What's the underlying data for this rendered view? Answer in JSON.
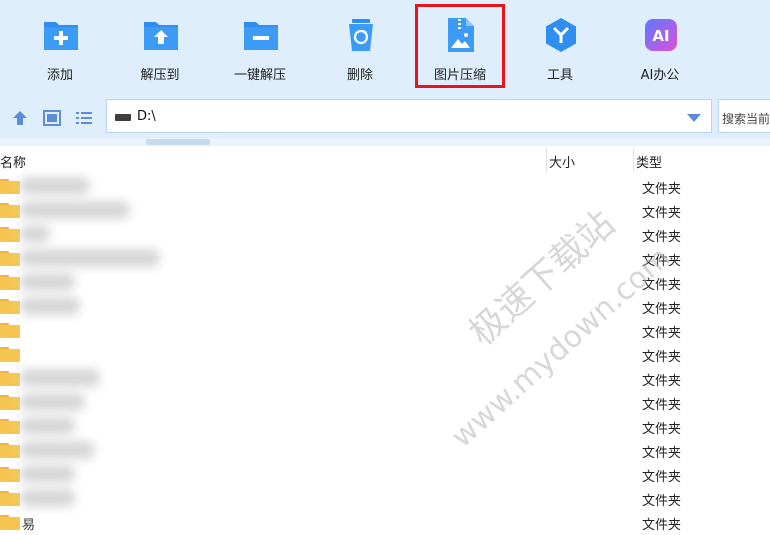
{
  "toolbar": {
    "items": [
      {
        "label": "添加",
        "icon": "add-folder-icon"
      },
      {
        "label": "解压到",
        "icon": "extract-to-icon"
      },
      {
        "label": "一键解压",
        "icon": "one-click-extract-icon"
      },
      {
        "label": "删除",
        "icon": "recycle-bin-icon"
      },
      {
        "label": "图片压缩",
        "icon": "image-compress-icon"
      },
      {
        "label": "工具",
        "icon": "tools-hexagon-icon"
      },
      {
        "label": "AI办公",
        "icon": "ai-office-icon"
      }
    ]
  },
  "address": {
    "path": "D:\\",
    "search_placeholder": "搜索当前"
  },
  "columns": {
    "name": "名称",
    "size": "大小",
    "type": "类型"
  },
  "rows": [
    {
      "name_visible": "",
      "type": "文件夹"
    },
    {
      "name_visible": "",
      "type": "文件夹"
    },
    {
      "name_visible": "",
      "type": "文件夹"
    },
    {
      "name_visible": "",
      "type": "文件夹"
    },
    {
      "name_visible": "",
      "type": "文件夹"
    },
    {
      "name_visible": "",
      "type": "文件夹"
    },
    {
      "name_visible": "",
      "type": "文件夹"
    },
    {
      "name_visible": "",
      "type": "文件夹"
    },
    {
      "name_visible": "",
      "type": "文件夹"
    },
    {
      "name_visible": "",
      "type": "文件夹"
    },
    {
      "name_visible": "",
      "type": "文件夹"
    },
    {
      "name_visible": "",
      "type": "文件夹"
    },
    {
      "name_visible": "",
      "type": "文件夹"
    },
    {
      "name_visible": "",
      "type": "文件夹"
    },
    {
      "name_visible": "易",
      "type": "文件夹"
    }
  ],
  "watermark": {
    "line1": "极速下载站",
    "line2": "www.mydown.com"
  },
  "colors": {
    "toolbar_bg": "#dfeefc",
    "icon_blue": "#2f8ef0",
    "highlight_border": "#e8141b",
    "folder_yellow": "#f5c54f"
  }
}
